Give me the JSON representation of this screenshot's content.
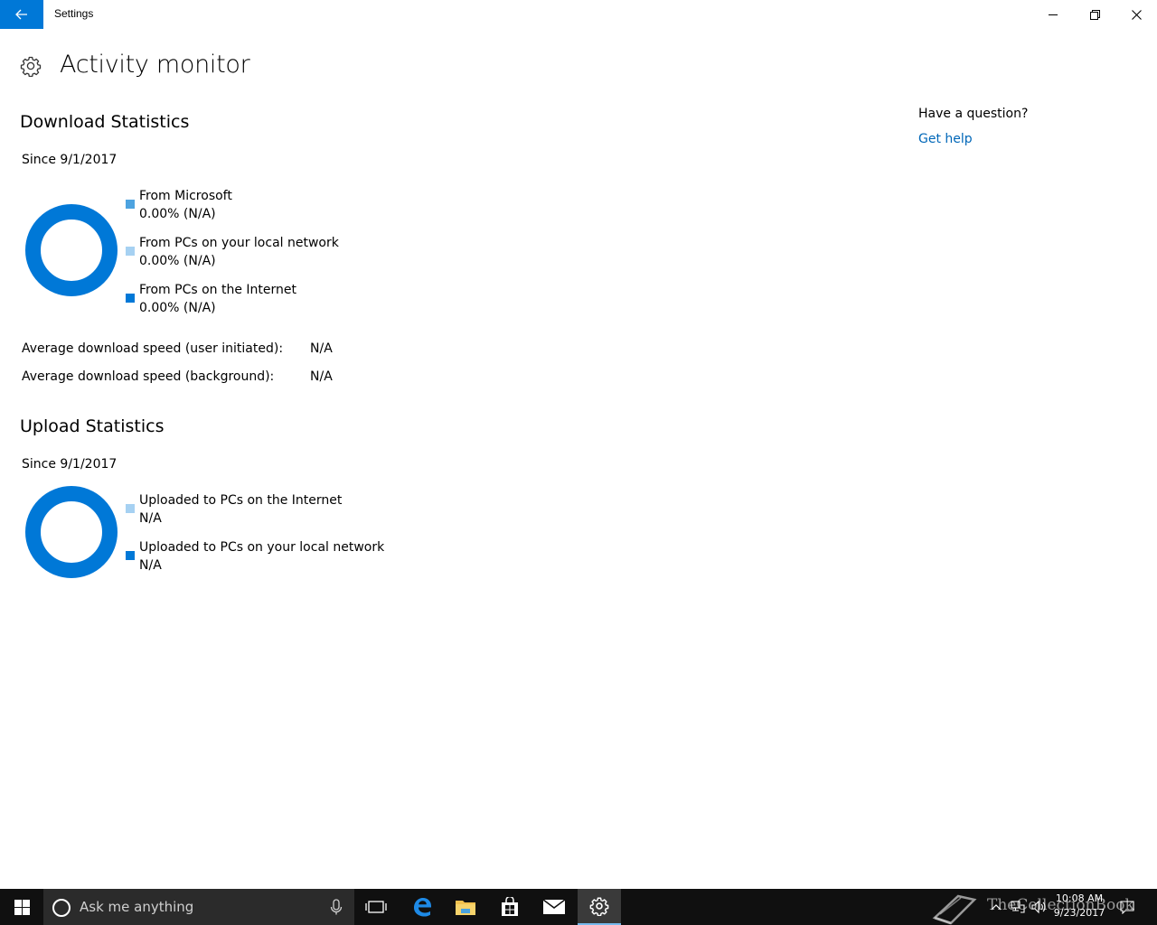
{
  "window": {
    "title": "Settings"
  },
  "page": {
    "title": "Activity monitor"
  },
  "download": {
    "heading": "Download Statistics",
    "since": "Since 9/1/2017",
    "legend": [
      {
        "label": "From Microsoft",
        "value": "0.00%  (N/A)",
        "color": "#4da3e0"
      },
      {
        "label": "From PCs on your local network",
        "value": "0.00%  (N/A)",
        "color": "#a6d1f2"
      },
      {
        "label": "From PCs on the Internet",
        "value": "0.00%  (N/A)",
        "color": "#0078d7"
      }
    ],
    "stats": [
      {
        "label": "Average download speed (user initiated):",
        "value": "N/A"
      },
      {
        "label": "Average download speed (background):",
        "value": "N/A"
      }
    ]
  },
  "upload": {
    "heading": "Upload Statistics",
    "since": "Since 9/1/2017",
    "legend": [
      {
        "label": "Uploaded to PCs on the Internet",
        "value": "N/A",
        "color": "#a6d1f2"
      },
      {
        "label": "Uploaded to PCs on your local network",
        "value": "N/A",
        "color": "#0078d7"
      }
    ]
  },
  "help": {
    "question": "Have a question?",
    "link": "Get help"
  },
  "taskbar": {
    "search_placeholder": "Ask me anything",
    "clock_time": "10:08 AM",
    "clock_date": "9/23/2017",
    "watermark": "TheCollectionBook",
    "pinned": [
      "task-view-icon",
      "edge-icon",
      "file-explorer-icon",
      "store-icon",
      "mail-icon",
      "settings-icon"
    ]
  },
  "colors": {
    "accent": "#0078d7",
    "link": "#0067b8",
    "donut": "#0078d7",
    "taskbar": "#101010"
  }
}
